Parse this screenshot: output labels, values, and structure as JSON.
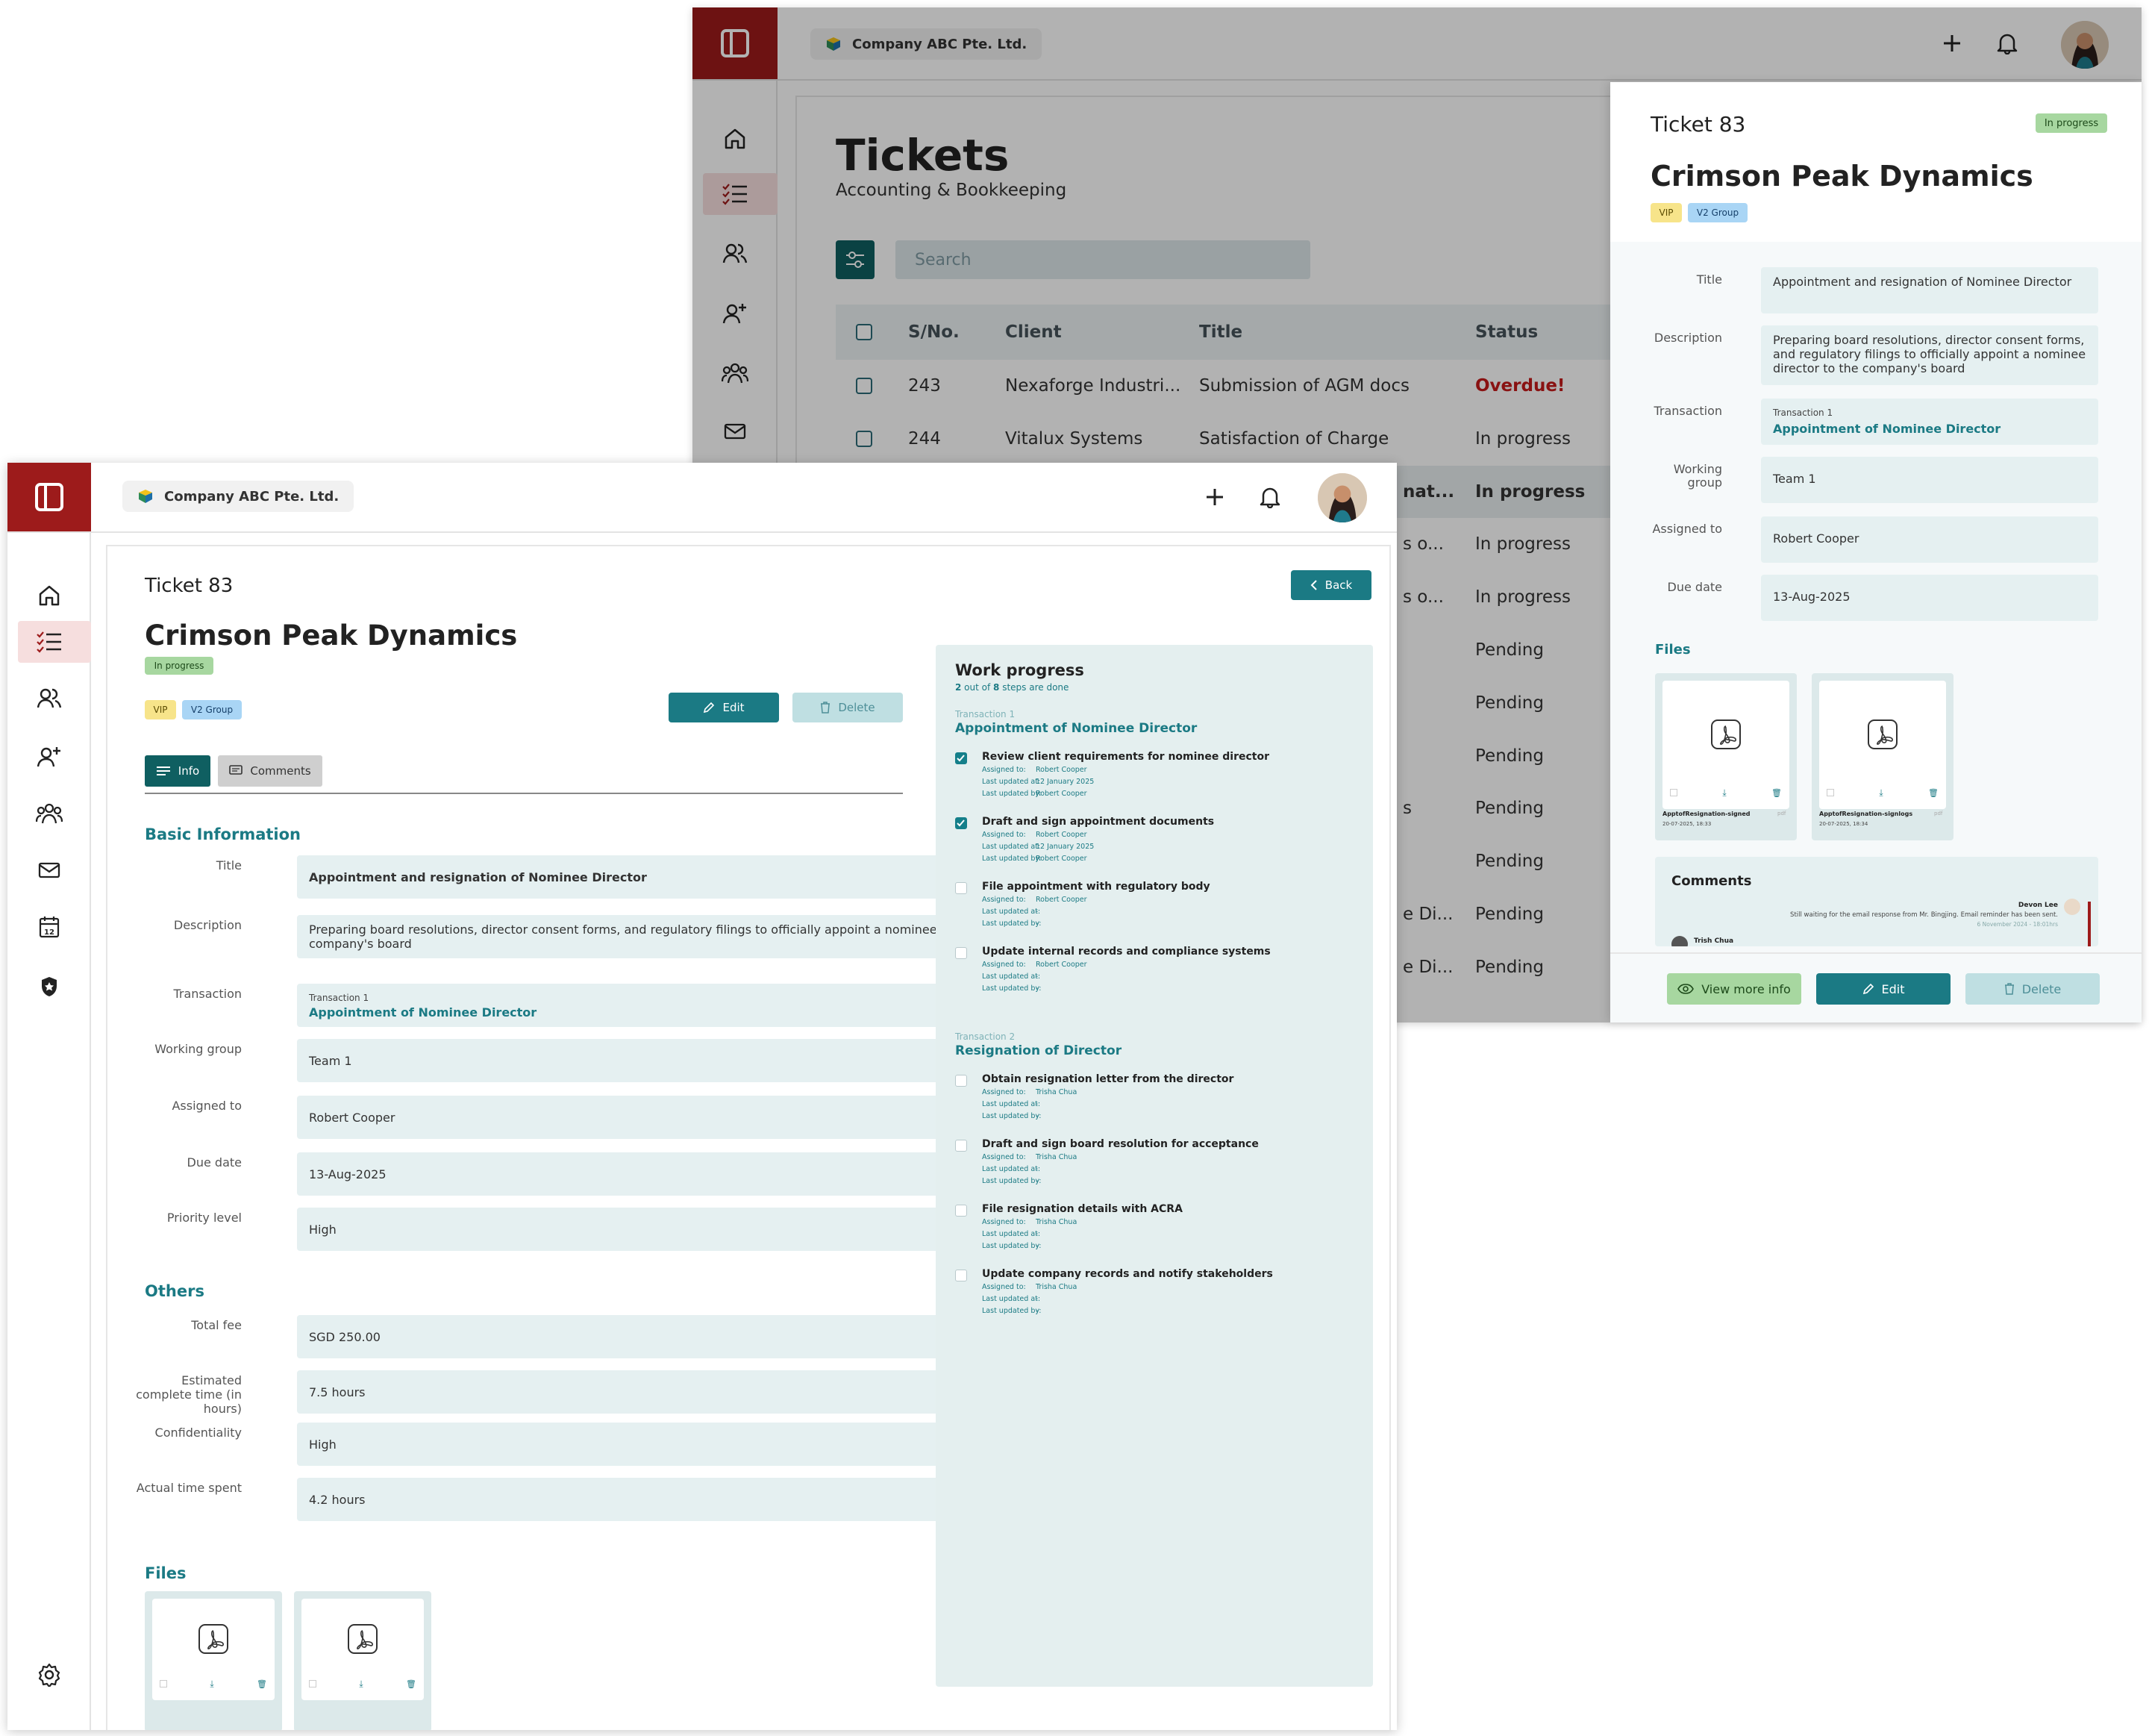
{
  "company": "Company ABC Pte. Ltd.",
  "back": {
    "page_title": "Tickets",
    "page_subtitle": "Accounting & Bookkeeping",
    "search_placeholder": "Search",
    "columns": [
      "S/No.",
      "Client",
      "Title",
      "Status"
    ],
    "rows": [
      {
        "sn": "243",
        "client": "Nexaforge Industri...",
        "title": "Submission of  AGM docs",
        "status": "Overdue!"
      },
      {
        "sn": "244",
        "client": "Vitalux Systems",
        "title": "Satisfaction of Charge",
        "status": "In progress"
      }
    ],
    "partial_rows": [
      {
        "frag": "nat...",
        "status": "In progress"
      },
      {
        "frag": "s o...",
        "status": "In progress"
      },
      {
        "frag": "s o...",
        "status": "In progress"
      },
      {
        "frag": "",
        "status": "Pending"
      },
      {
        "frag": "",
        "status": "Pending"
      },
      {
        "frag": "",
        "status": "Pending"
      },
      {
        "frag": "s",
        "status": "Pending"
      },
      {
        "frag": "",
        "status": "Pending"
      },
      {
        "frag": "e Di...",
        "status": "Pending"
      },
      {
        "frag": "e Di...",
        "status": "Pending"
      }
    ]
  },
  "panel": {
    "ticket": "Ticket 83",
    "status_badge": "In progress",
    "client": "Crimson Peak Dynamics",
    "tags": [
      "VIP",
      "V2 Group"
    ],
    "fields": [
      {
        "label": "Title",
        "value": "Appointment and resignation of Nominee Director"
      },
      {
        "label": "Description",
        "value": "Preparing board resolutions, director consent forms, and regulatory filings to officially appoint a nominee director to the company's board"
      },
      {
        "label": "Transaction",
        "small": "Transaction 1",
        "value": "Appointment of Nominee Director"
      },
      {
        "label": "Working group",
        "value": "Team 1"
      },
      {
        "label": "Assigned to",
        "value": "Robert Cooper"
      },
      {
        "label": "Due date",
        "value": "13-Aug-2025"
      }
    ],
    "files_heading": "Files",
    "files": [
      {
        "name": "ApptofResignation-signed",
        "date": "20-07-2025, 18:33",
        "ext": "pdf"
      },
      {
        "name": "ApptofResignation-signlogs",
        "date": "20-07-2025, 18:34",
        "ext": "pdf"
      }
    ],
    "comments_heading": "Comments",
    "comment": {
      "author": "Devon Lee",
      "text": "Still waiting for the email response from Mr. Bingjing. Email reminder has been sent.",
      "time": "6 November 2024 - 18:01hrs"
    },
    "comment2_author": "Trish Chua",
    "buttons": {
      "view": "View more info",
      "edit": "Edit",
      "delete": "Delete"
    }
  },
  "front": {
    "ticket": "Ticket 83",
    "back_btn": "Back",
    "client": "Crimson Peak Dynamics",
    "status_badge": "In progress",
    "tags": [
      "VIP",
      "V2 Group"
    ],
    "edit_btn": "Edit",
    "delete_btn": "Delete",
    "tabs": [
      "Info",
      "Comments"
    ],
    "basic_heading": "Basic Information",
    "basic_fields": [
      {
        "label": "Title",
        "value": "Appointment and resignation of Nominee Director"
      },
      {
        "label": "Description",
        "value": "Preparing board resolutions, director consent forms, and regulatory filings to officially appoint a nominee director to the company's board"
      },
      {
        "label": "Transaction",
        "small": "Transaction 1",
        "value": "Appointment of Nominee Director"
      },
      {
        "label": "Working group",
        "value": "Team 1"
      },
      {
        "label": "Assigned to",
        "value": "Robert Cooper"
      },
      {
        "label": "Due date",
        "value": "13-Aug-2025"
      },
      {
        "label": "Priority level",
        "value": "High"
      }
    ],
    "others_heading": "Others",
    "other_fields": [
      {
        "label": "Total fee",
        "value": "SGD 250.00"
      },
      {
        "label": "Estimated complete time (in hours)",
        "value": "7.5 hours"
      },
      {
        "label": "Confidentiality",
        "value": "High"
      },
      {
        "label": "Actual time spent",
        "value": "4.2 hours"
      }
    ],
    "files_heading": "Files",
    "work": {
      "heading": "Work progress",
      "done": "2",
      "mid": " out of ",
      "total": "8",
      "suffix": " steps are done",
      "labels": {
        "assigned": "Assigned to:",
        "updated_at": "Last updated at:",
        "updated_by": "Last updated by:"
      },
      "transactions": [
        {
          "label": "Transaction 1",
          "name": "Appointment of Nominee Director",
          "steps": [
            {
              "title": "Review client requirements for nominee director",
              "done": true,
              "assigned": "Robert Cooper",
              "at": "12 January 2025",
              "by": "Robert Cooper"
            },
            {
              "title": "Draft and sign appointment documents",
              "done": true,
              "assigned": "Robert Cooper",
              "at": "12 January 2025",
              "by": "Robert Cooper"
            },
            {
              "title": "File appointment with regulatory body",
              "done": false,
              "assigned": "Robert Cooper",
              "at": "-",
              "by": "-"
            },
            {
              "title": "Update internal records and compliance systems",
              "done": false,
              "assigned": "Robert Cooper",
              "at": "-",
              "by": "-"
            }
          ]
        },
        {
          "label": "Transaction 2",
          "name": "Resignation of Director",
          "steps": [
            {
              "title": "Obtain resignation letter from the director",
              "done": false,
              "assigned": "Trisha Chua",
              "at": "-",
              "by": "-"
            },
            {
              "title": "Draft and sign board resolution for acceptance",
              "done": false,
              "assigned": "Trisha Chua",
              "at": "-",
              "by": "-"
            },
            {
              "title": "File resignation details with ACRA",
              "done": false,
              "assigned": "Trisha Chua",
              "at": "-",
              "by": "-"
            },
            {
              "title": "Update company records and notify stakeholders",
              "done": false,
              "assigned": "Trisha Chua",
              "at": "-",
              "by": "-"
            }
          ]
        }
      ]
    }
  },
  "colors": {
    "brand_red": "#9d1b1b",
    "teal": "#1b7a84",
    "dark_teal": "#0f5f61",
    "overdue": "#c41a1a",
    "badge_green": "#a7d7a0",
    "badge_yellow": "#f7e48a",
    "badge_blue": "#a9d5f5"
  }
}
